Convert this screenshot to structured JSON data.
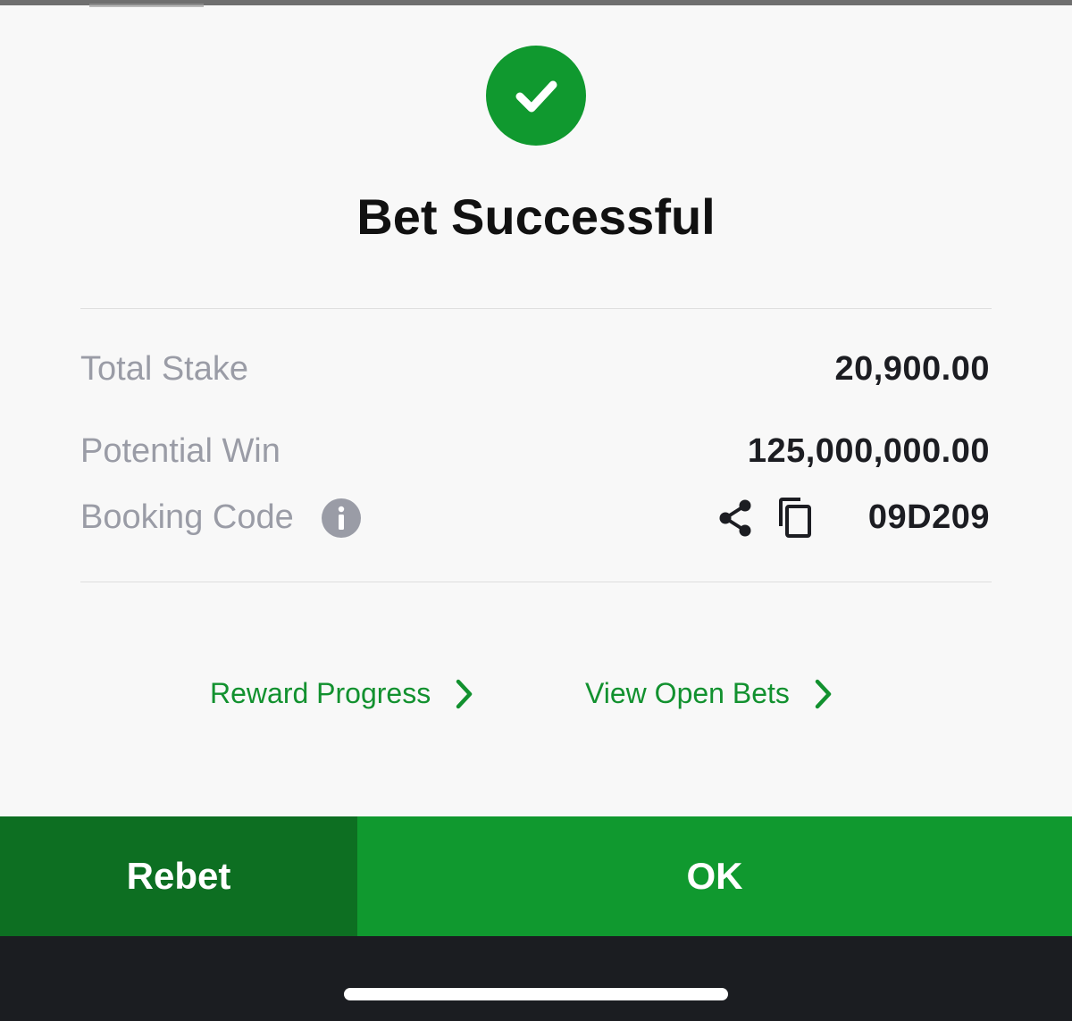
{
  "dialog": {
    "title": "Bet Successful",
    "status_color": "#10992f",
    "icon": "checkmark-icon"
  },
  "summary": {
    "total_stake_label": "Total Stake",
    "total_stake_value": "20,900.00",
    "potential_win_label": "Potential Win",
    "potential_win_value": "125,000,000.00",
    "booking_code_label": "Booking Code",
    "booking_code_value": "09D209",
    "icons": [
      "info-icon",
      "share-icon",
      "copy-icon"
    ]
  },
  "links": {
    "reward_progress": "Reward Progress",
    "view_open_bets": "View Open Bets"
  },
  "actions": {
    "rebet_label": "Rebet",
    "ok_label": "OK"
  },
  "colors": {
    "primary_green": "#10992f",
    "dark_green": "#0d6f22",
    "link_green": "#12912f",
    "label_grey": "#9a9ca6"
  }
}
